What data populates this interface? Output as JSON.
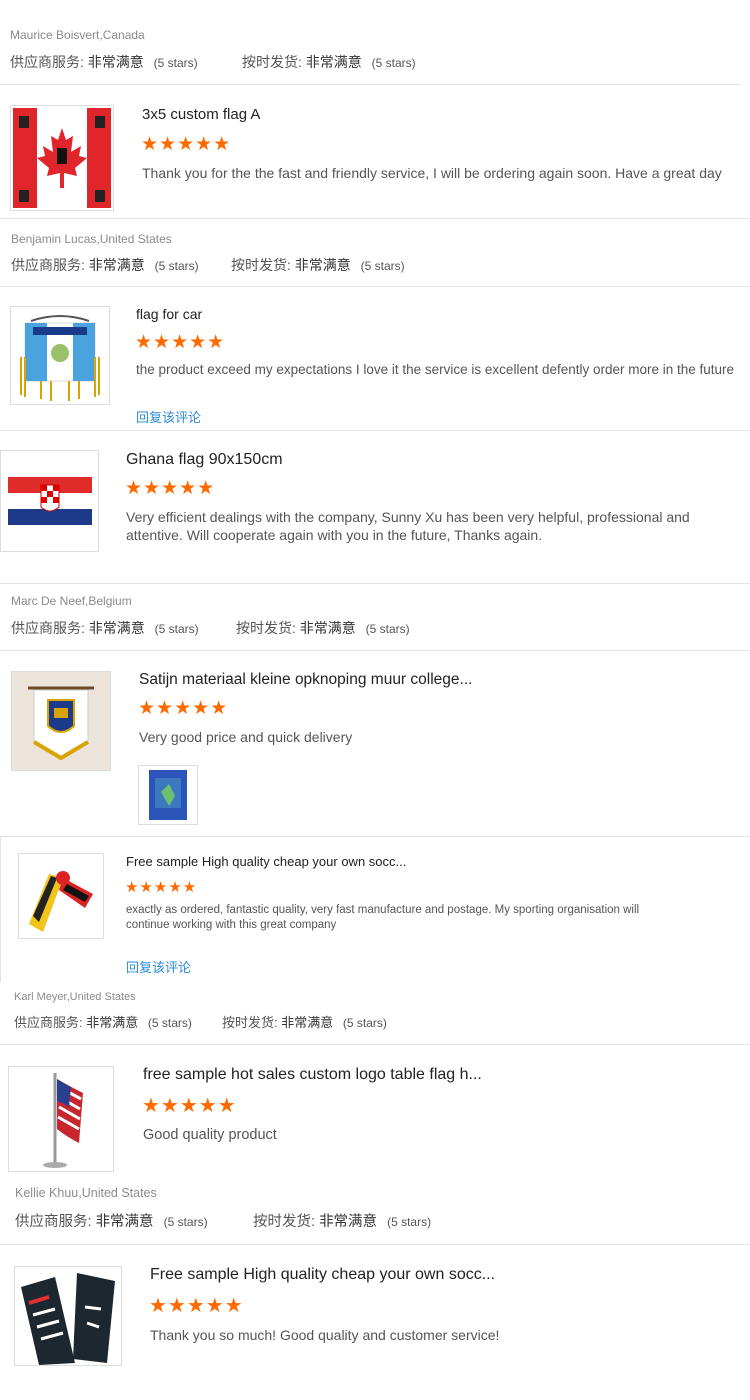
{
  "labels": {
    "supplier_service": "供应商服务:",
    "on_time_shipping": "按时发货:",
    "very_satisfied": "非常满意",
    "five_stars": "(5 stars)",
    "reply": "回复该评论",
    "stars_glyphs": "★★★★★"
  },
  "colors": {
    "star": "#ff6a00",
    "link": "#2c8bd8"
  },
  "reviews": [
    {
      "reviewer": "Maurice Boisvert,Canada",
      "product": "3x5 custom flag A",
      "rating": 5,
      "text": "Thank you for the the fast and friendly service, I will be ordering again soon. Have a great day",
      "thumb_icon": "canada-flag-image"
    },
    {
      "reviewer": "Benjamin Lucas,United States",
      "product": "flag for car",
      "rating": 5,
      "text": "the product exceed my expectations I love it the service is excellent defently order more in the future",
      "thumb_icon": "guatemala-car-flag-image"
    },
    {
      "reviewer": "",
      "product": "Ghana flag 90x150cm",
      "rating": 5,
      "text": "Very efficient dealings with the company, Sunny Xu has been very helpful, professional and attentive. Will cooperate again with you in the future, Thanks again.",
      "thumb_icon": "croatia-flag-image"
    },
    {
      "reviewer": "Marc De Neef,Belgium",
      "product": "Satijn materiaal kleine opknoping muur college...",
      "rating": 5,
      "text": "Very good price and quick delivery",
      "thumb_icon": "pennant-banner-image"
    },
    {
      "reviewer": "",
      "product": "Free sample High quality cheap your own socc...",
      "rating": 5,
      "text": "exactly as ordered, fantastic quality, very fast manufacture and postage. My sporting organisation will continue working with this great company",
      "thumb_icon": "soccer-scarf-image"
    },
    {
      "reviewer": "Karl Meyer,United States",
      "product": "free sample hot sales custom logo table flag h...",
      "rating": 5,
      "text": "Good quality product",
      "thumb_icon": "usa-table-flag-image"
    },
    {
      "reviewer": "Kellie Khuu,United States",
      "product": "Free sample High quality cheap your own socc...",
      "rating": 5,
      "text": "Thank you so much!  Good quality and customer service!",
      "thumb_icon": "team-scarf-image"
    }
  ]
}
